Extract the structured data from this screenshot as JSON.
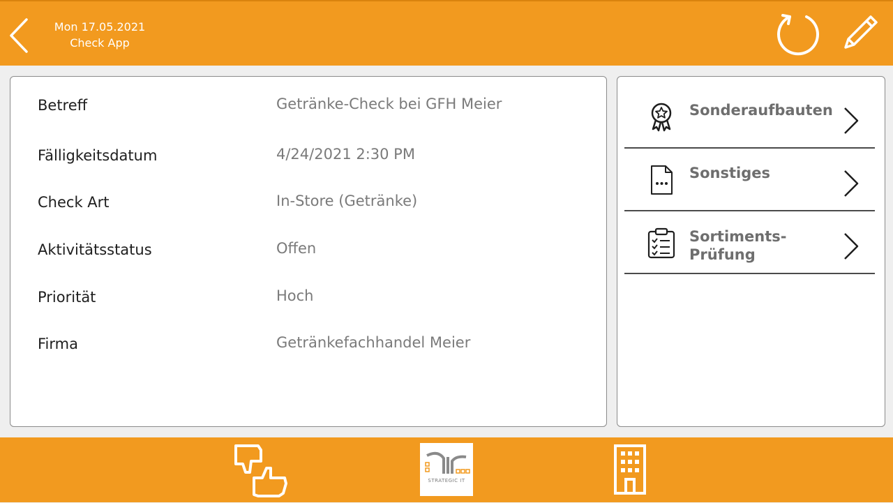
{
  "header": {
    "date": "Mon 17.05.2021",
    "app_title": "Check App",
    "icons": [
      "back-arrow-icon",
      "refresh-icon",
      "pencil-icon"
    ]
  },
  "details": {
    "rows": [
      {
        "label": "Betreff",
        "value": "Getränke-Check bei GFH Meier"
      },
      {
        "label": "Fälligkeitsdatum",
        "value": "4/24/2021 2:30 PM"
      },
      {
        "label": "Check Art",
        "value": "In-Store (Getränke)"
      },
      {
        "label": "Aktivitätsstatus",
        "value": "Offen"
      },
      {
        "label": "Priorität",
        "value": "Hoch"
      },
      {
        "label": "Firma",
        "value": "Getränkefachhandel Meier"
      }
    ]
  },
  "side_nav": {
    "items": [
      {
        "label_line1": "Sonderaufbauten",
        "label_line2": "",
        "icon": "award-ribbon-icon"
      },
      {
        "label_line1": "Sonstiges",
        "label_line2": "",
        "icon": "document-icon"
      },
      {
        "label_line1": "Sortiments-",
        "label_line2": "Prüfung",
        "icon": "clipboard-checklist-icon"
      }
    ]
  },
  "footer": {
    "logo_text": "STRATEGIC IT",
    "icons": [
      "thumbs-up-down-icon",
      "strategic-it-logo",
      "building-icon"
    ]
  },
  "colors": {
    "accent": "#f29a1f",
    "background": "#efefef",
    "label": "#1e1e1e",
    "value": "#7a7a7a"
  }
}
